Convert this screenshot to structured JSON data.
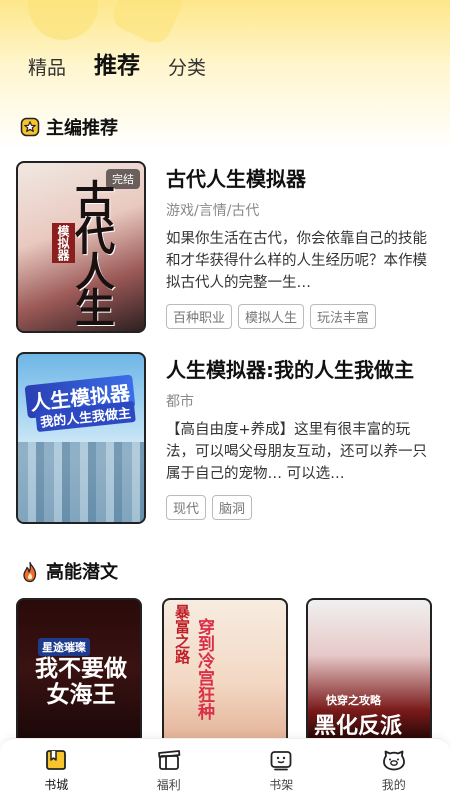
{
  "header": {
    "tabs": [
      {
        "label": "精品",
        "active": false
      },
      {
        "label": "推荐",
        "active": true
      },
      {
        "label": "分类",
        "active": false
      }
    ]
  },
  "sections": {
    "editor_pick": {
      "title": "主编推荐",
      "icon": "star-badge-icon"
    },
    "hidden_gems": {
      "title": "高能潜文",
      "icon": "flame-icon"
    }
  },
  "books": [
    {
      "title": "古代人生模拟器",
      "genre": "游戏/言情/古代",
      "desc": "如果你生活在古代，你会依靠自己的技能和才华获得什么样的人生经历呢？本作模拟古代人的完整一生…",
      "tags": [
        "百种职业",
        "模拟人生",
        "玩法丰富"
      ],
      "badge": "完结",
      "cover_title": "古代人生",
      "cover_sub": "模拟器"
    },
    {
      "title": "人生模拟器:我的人生我做主",
      "genre": "都市",
      "desc": "【高自由度+养成】这里有很丰富的玩法，可以喝父母朋友互动，还可以养一只属于自己的宠物… 可以选…",
      "tags": [
        "现代",
        "脑洞"
      ],
      "cover_title": "人生模拟器",
      "cover_sub": "我的人生我做主"
    }
  ],
  "mini_books": [
    {
      "cover_top": "星途璀璨",
      "cover_title": "我不要做女海王"
    },
    {
      "cover_top": "暴富之路",
      "cover_title": "穿到冷宫狂种"
    },
    {
      "cover_top": "快穿之攻略",
      "cover_title": "黑化反派"
    }
  ],
  "bottom_nav": [
    {
      "label": "书城",
      "icon": "bookstore-icon",
      "active": true
    },
    {
      "label": "福利",
      "icon": "gift-box-icon",
      "active": false
    },
    {
      "label": "书架",
      "icon": "bookshelf-icon",
      "active": false
    },
    {
      "label": "我的",
      "icon": "profile-face-icon",
      "active": false
    }
  ],
  "colors": {
    "accent_yellow": "#fde78a",
    "text_dark": "#111111",
    "tag_border": "#bbbbbb"
  }
}
